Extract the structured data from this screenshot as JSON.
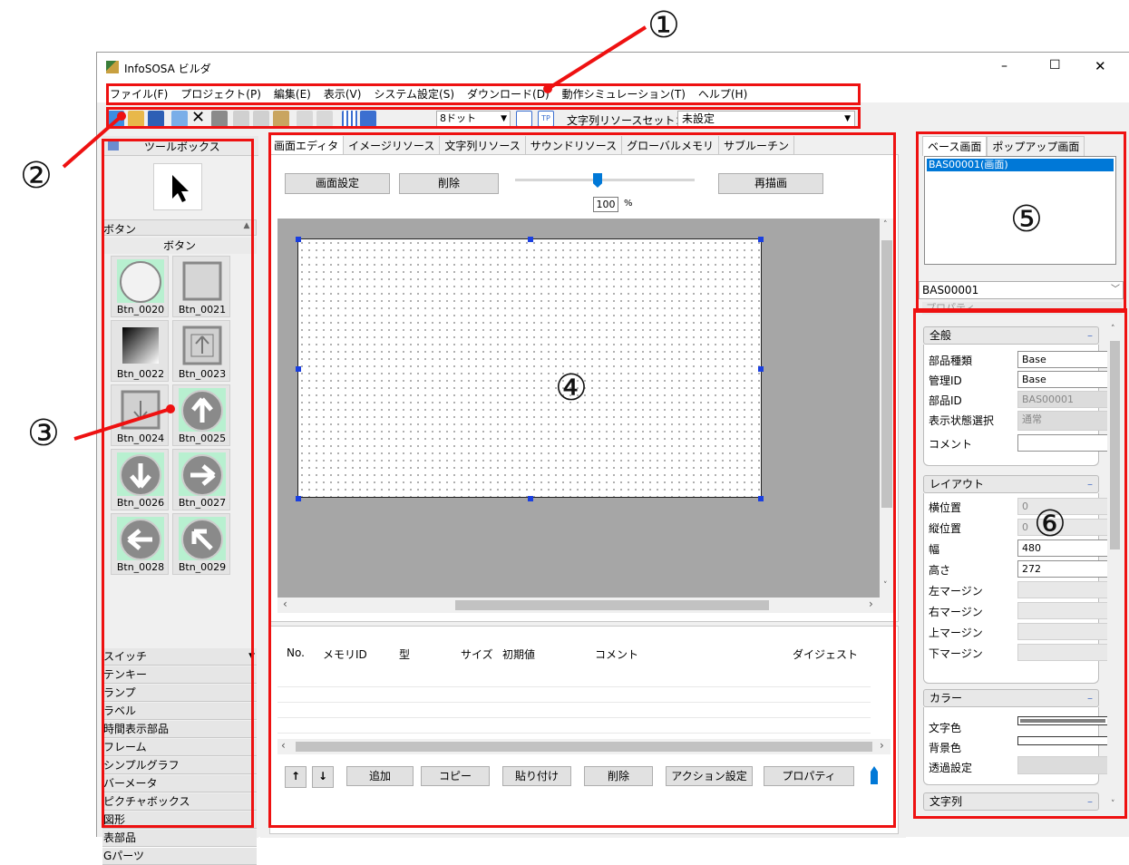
{
  "window": {
    "title": "InfoSOSA ビルダ",
    "minimize": "–",
    "maximize": "☐",
    "close": "✕"
  },
  "menu": [
    "ファイル(F)",
    "プロジェクト(P)",
    "編集(E)",
    "表示(V)",
    "システム設定(S)",
    "ダウンロード(D)",
    "動作シミュレーション(T)",
    "ヘルプ(H)"
  ],
  "toolbar": {
    "grid_select": "8ドット",
    "resource_label": "文字列リソースセット：",
    "resource_value": "未設定"
  },
  "toolbox": {
    "title": "ツールボックス",
    "section": "ボタン",
    "subsection": "ボタン",
    "tiles": [
      "Btn_0020",
      "Btn_0021",
      "Btn_0022",
      "Btn_0023",
      "Btn_0024",
      "Btn_0025",
      "Btn_0026",
      "Btn_0027",
      "Btn_0028",
      "Btn_0029"
    ],
    "categories": [
      "スイッチ",
      "テンキー",
      "ランプ",
      "ラベル",
      "時間表示部品",
      "フレーム",
      "シンプルグラフ",
      "バーメータ",
      "ピクチャボックス",
      "図形",
      "表部品",
      "Gパーツ"
    ]
  },
  "editor": {
    "tabs": [
      "画面エディタ",
      "イメージリソース",
      "文字列リソース",
      "サウンドリソース",
      "グローバルメモリ",
      "サブルーチン"
    ],
    "screen_settings": "画面設定",
    "delete": "削除",
    "redraw": "再描画",
    "zoom_value": "100",
    "zoom_unit": "%"
  },
  "memory_table": {
    "columns": [
      "No.",
      "メモリID",
      "型",
      "サイズ",
      "初期値",
      "コメント",
      "ダイジェスト"
    ],
    "buttons": [
      "追加",
      "コピー",
      "貼り付け",
      "削除",
      "アクション設定",
      "プロパティ"
    ],
    "up": "↑",
    "down": "↓"
  },
  "screens": {
    "tabs": [
      "ベース画面",
      "ポップアップ画面"
    ],
    "items": [
      "BAS00001(画面)"
    ],
    "selected": "BAS00001",
    "props_header": "プロパティ"
  },
  "properties": {
    "general": {
      "title": "全般",
      "rows": [
        {
          "label": "部品種類",
          "value": "Base"
        },
        {
          "label": "管理ID",
          "value": "Base"
        },
        {
          "label": "部品ID",
          "value": "BAS00001"
        },
        {
          "label": "表示状態選択",
          "value": "通常"
        },
        {
          "label": "コメント",
          "value": ""
        }
      ]
    },
    "layout": {
      "title": "レイアウト",
      "rows": [
        {
          "label": "横位置",
          "value": "0"
        },
        {
          "label": "縦位置",
          "value": "0"
        },
        {
          "label": "幅",
          "value": "480"
        },
        {
          "label": "高さ",
          "value": "272"
        },
        {
          "label": "左マージン",
          "value": ""
        },
        {
          "label": "右マージン",
          "value": ""
        },
        {
          "label": "上マージン",
          "value": ""
        },
        {
          "label": "下マージン",
          "value": ""
        }
      ]
    },
    "color": {
      "title": "カラー",
      "rows": [
        {
          "label": "文字色",
          "value": ""
        },
        {
          "label": "背景色",
          "value": ""
        },
        {
          "label": "透過設定",
          "value": ""
        }
      ]
    },
    "string": {
      "title": "文字列"
    },
    "collapse": "–"
  },
  "annotations": {
    "n1": "①",
    "n2": "②",
    "n3": "③",
    "n4": "④",
    "n5": "⑤",
    "n6": "⑥"
  },
  "colors": {
    "annotation_red": "#ee1111",
    "selection_blue": "#0078d7",
    "handle_blue": "#1a3fe0"
  }
}
